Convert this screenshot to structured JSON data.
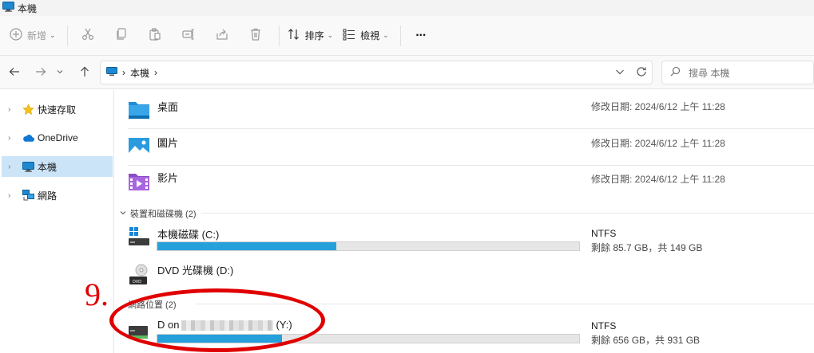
{
  "window": {
    "title": "本機"
  },
  "toolbar": {
    "new_label": "新增",
    "sort_label": "排序",
    "view_label": "檢視",
    "more_label": "···"
  },
  "address": {
    "crumb": "本機",
    "separator": "›"
  },
  "search": {
    "placeholder": "搜尋 本機"
  },
  "sidebar": {
    "items": [
      {
        "label": "快速存取"
      },
      {
        "label": "OneDrive"
      },
      {
        "label": "本機"
      },
      {
        "label": "網路"
      }
    ]
  },
  "folders": [
    {
      "name": "桌面",
      "modified": "修改日期: 2024/6/12 上午 11:28"
    },
    {
      "name": "圖片",
      "modified": "修改日期: 2024/6/12 上午 11:28"
    },
    {
      "name": "影片",
      "modified": "修改日期: 2024/6/12 上午 11:28"
    }
  ],
  "devices_group": {
    "header": "裝置和磁碟機 (2)",
    "drives": [
      {
        "name": "本機磁碟 (C:)",
        "fs": "NTFS",
        "space": "剩餘 85.7 GB，共 149 GB",
        "used_fraction": 0.425
      },
      {
        "name": "DVD 光碟機 (D:)"
      }
    ]
  },
  "network_group": {
    "header": "網路位置 (2)",
    "drives": [
      {
        "name_prefix": "D on",
        "name_suffix": "(Y:)",
        "fs": "NTFS",
        "space": "剩餘 656 GB，共 931 GB",
        "used_fraction": 0.295
      }
    ]
  },
  "annotation": {
    "number": "9."
  },
  "colors": {
    "accent": "#26a0da",
    "annotation": "#e00000",
    "selected": "#cce4f7"
  }
}
